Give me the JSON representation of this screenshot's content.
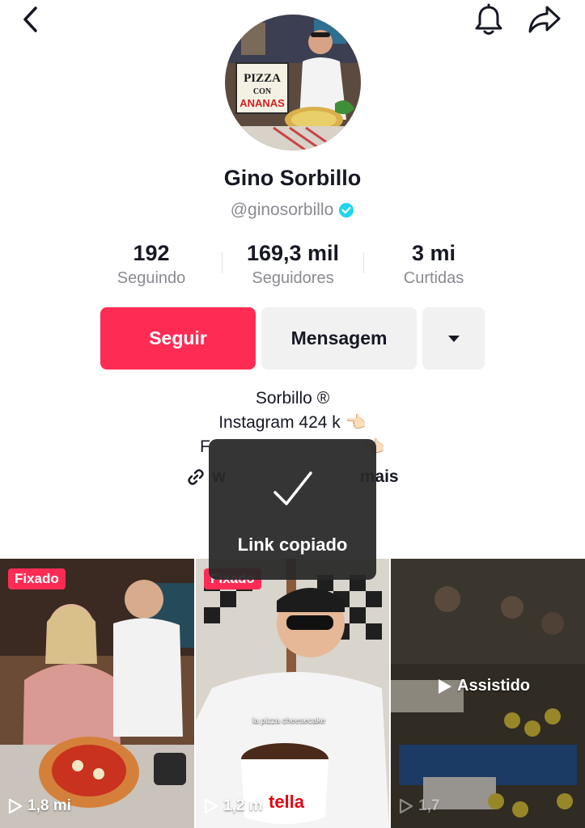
{
  "profile": {
    "name": "Gino Sorbillo",
    "handle": "@ginosorbillo",
    "verified": true,
    "avatar_sign_text": [
      "PIZZA",
      "CON",
      "ANANAS"
    ]
  },
  "stats": [
    {
      "value": "192",
      "label": "Seguindo"
    },
    {
      "value": "169,3 mil",
      "label": "Seguidores"
    },
    {
      "value": "3 mi",
      "label": "Curtidas"
    }
  ],
  "actions": {
    "follow_label": "Seguir",
    "message_label": "Mensagem"
  },
  "bio": {
    "line1": "Sorbillo ®",
    "line2": "Instagram 424 k 👈🏻",
    "line3_start": "F",
    "line3_end": "👈🏻",
    "link_start": "w",
    "link_end": "mais"
  },
  "toast": {
    "text": "Link copiado"
  },
  "videos": [
    {
      "pinned_label": "Fixado",
      "views": "1,8 mi"
    },
    {
      "pinned_label": "Fixado",
      "views": "1,2 m",
      "caption": "la pizza cheesecake",
      "jar_label": "tella"
    },
    {
      "status": "Assistido",
      "views": "1,7"
    }
  ],
  "colors": {
    "accent": "#fe2c55",
    "verified": "#20d5ec",
    "secondary_button": "#f1f1f2",
    "muted_text": "#8a8b91",
    "toast_bg": "#282828"
  },
  "icons": [
    "back-icon",
    "bell-icon",
    "share-icon",
    "verified-icon",
    "dropdown-icon",
    "link-icon",
    "check-icon",
    "play-icon"
  ]
}
